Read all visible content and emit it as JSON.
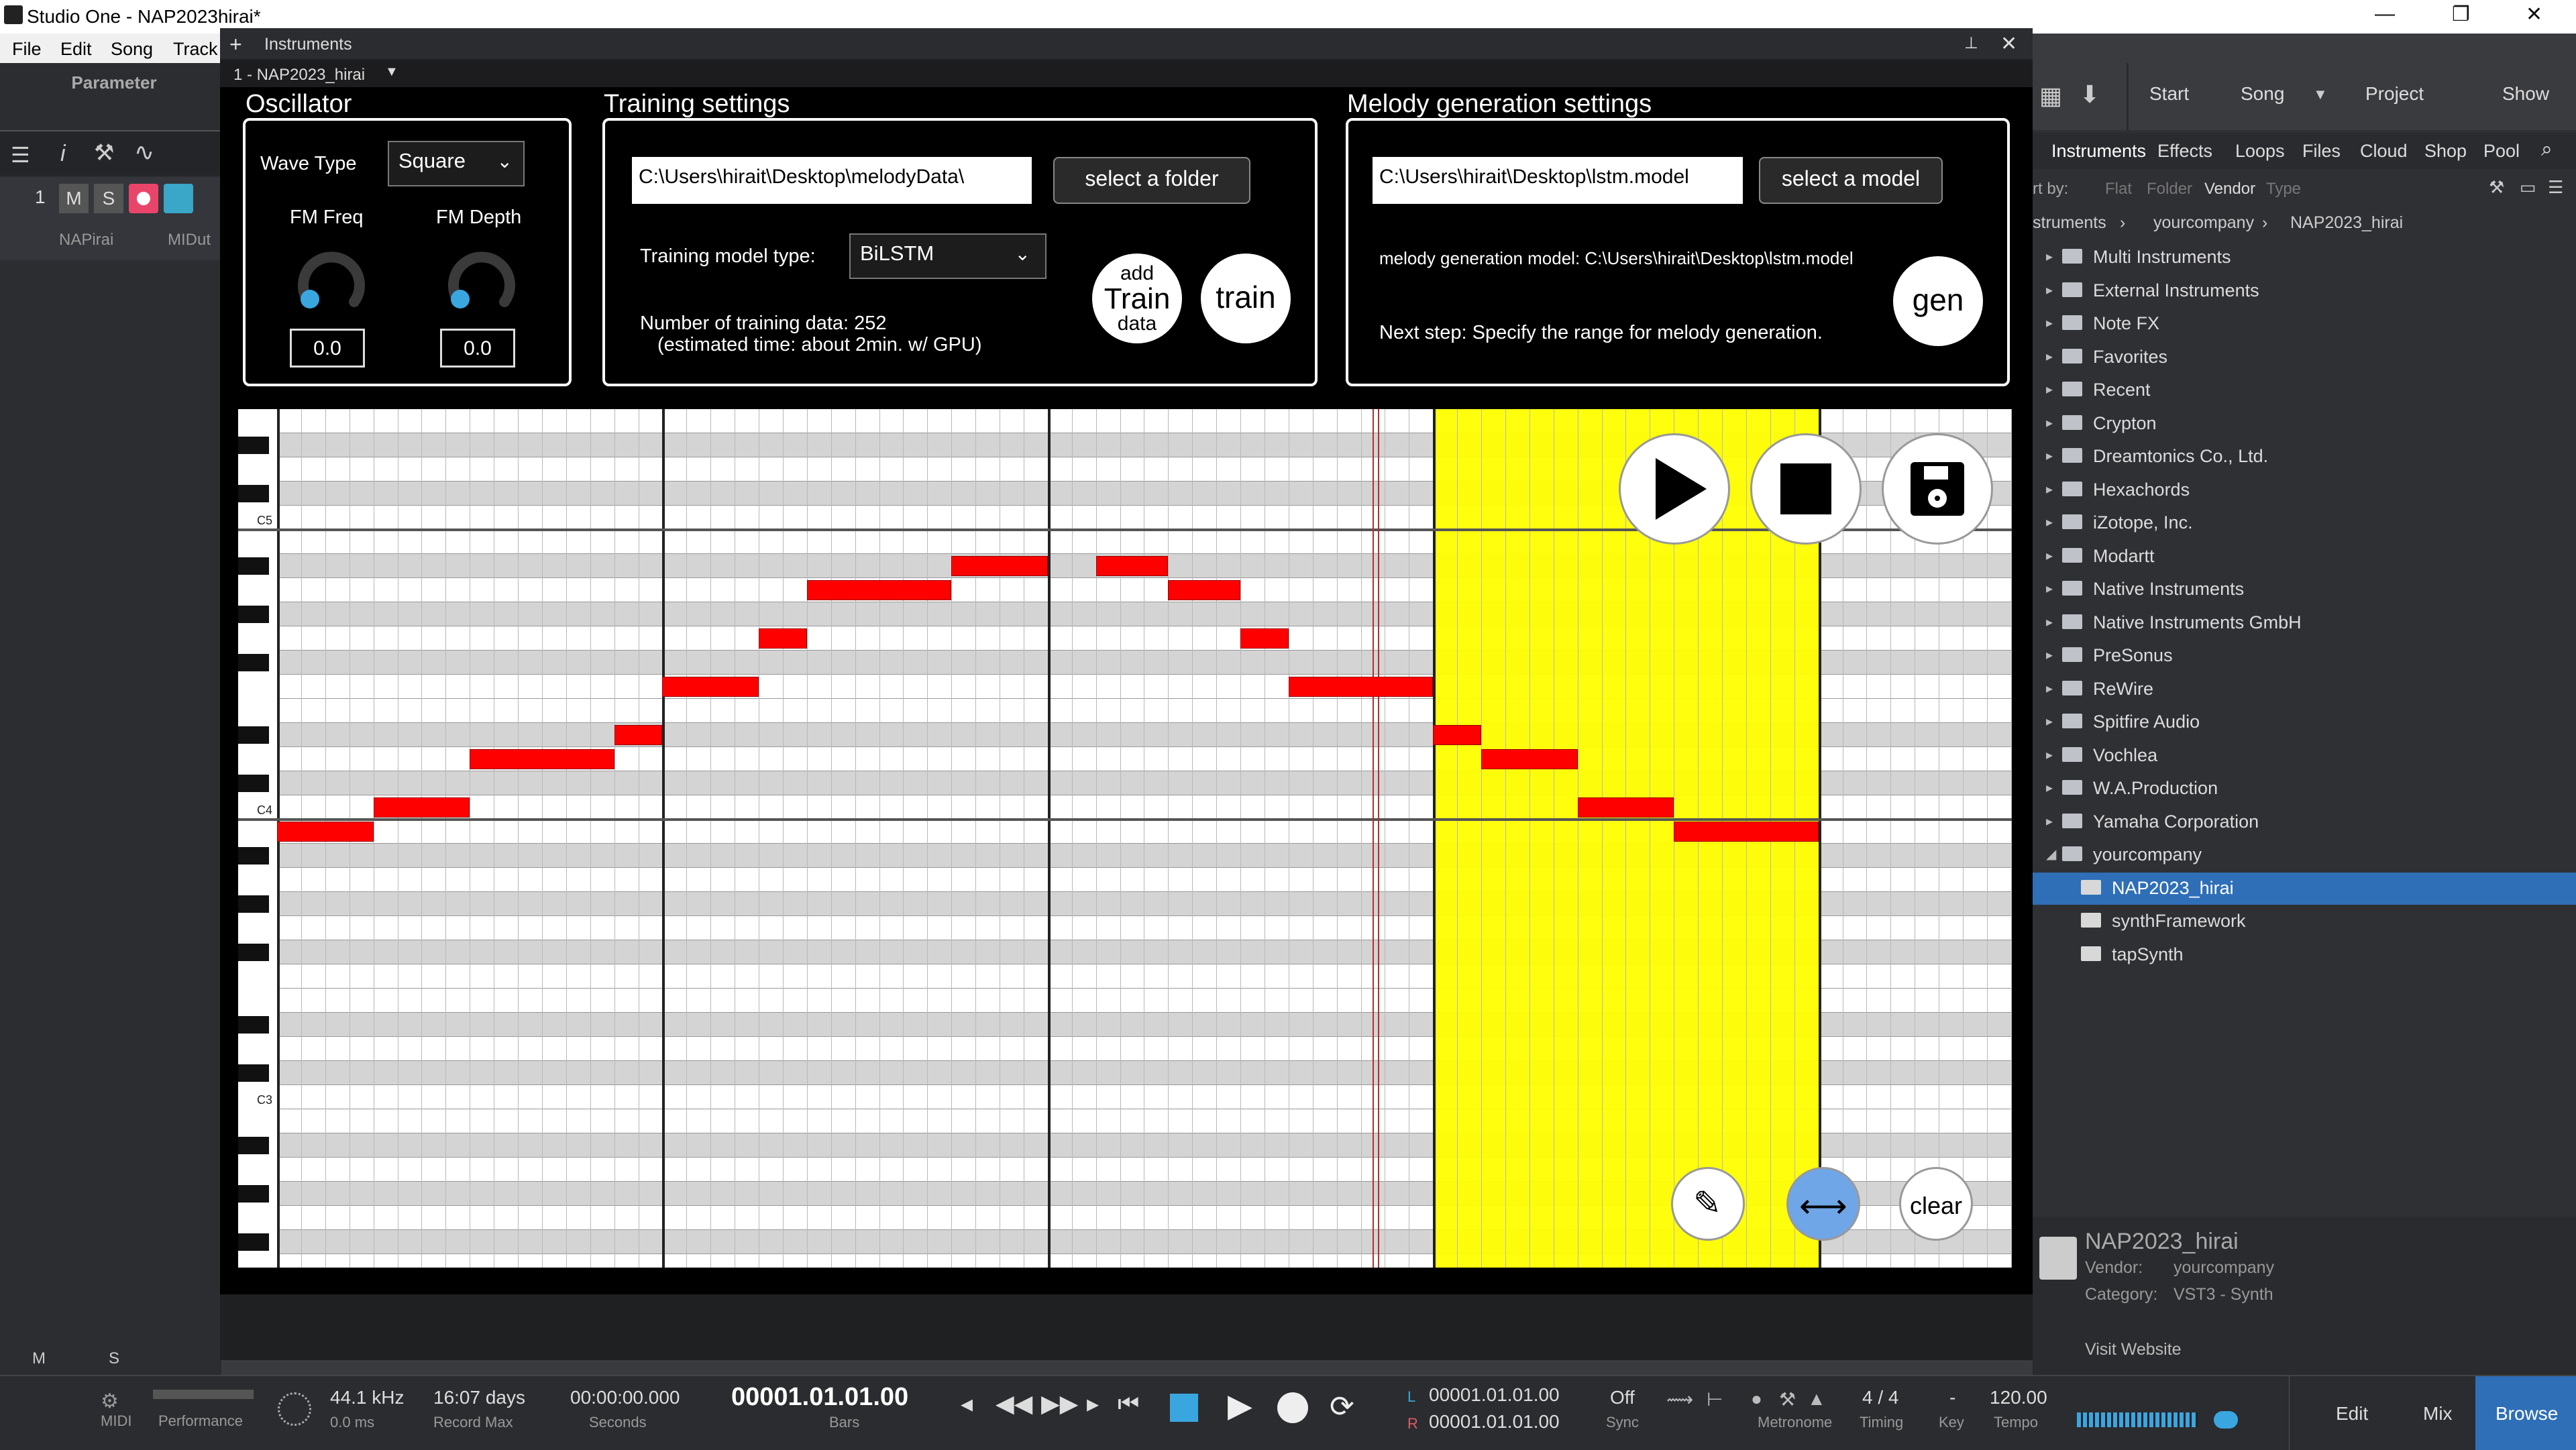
{
  "window": {
    "title": "Studio One - NAP2023hirai*",
    "minimize": "—",
    "maximize": "❐",
    "close": "✕"
  },
  "menu": [
    "File",
    "Edit",
    "Song",
    "Track"
  ],
  "left": {
    "parameter_label": "Parameter",
    "track_number": "1",
    "track_buttons": [
      "M",
      "S"
    ],
    "instrument_tag": "NAPirai",
    "midi_tag": "MIDut",
    "bottom_m": "M",
    "bottom_s": "S"
  },
  "plugin": {
    "header": "Instruments",
    "add": "+",
    "pin": "📌",
    "close": "✕",
    "preset": "1 - NAP2023_hirai",
    "oscillator": {
      "title": "Oscillator",
      "wave_type_label": "Wave Type",
      "wave_type_value": "Square",
      "fm_freq_label": "FM Freq",
      "fm_depth_label": "FM Depth",
      "fm_freq_value": "0.0",
      "fm_depth_value": "0.0"
    },
    "training": {
      "title": "Training settings",
      "folder_path": "C:\\Users\\hirait\\Desktop\\melodyData\\",
      "select_folder": "select a folder",
      "model_type_label": "Training model type:",
      "model_type_value": "BiLSTM",
      "data_count": "Number of training data: 252",
      "estimate": "(estimated time: about 2min. w/ GPU)",
      "add_btn_1": "add",
      "add_btn_2": "Train",
      "add_btn_3": "data",
      "train_btn": "train"
    },
    "generation": {
      "title": "Melody generation settings",
      "model_path": "C:\\Users\\hirait\\Desktop\\lstm.model",
      "select_model": "select a model",
      "model_label": "melody generation model: C:\\Users\\hirait\\Desktop\\lstm.model",
      "next_step": "Next step: Specify the range for melody generation.",
      "gen_btn": "gen"
    },
    "roll": {
      "labels": {
        "c5": "C5",
        "c4": "C4",
        "c3": "C3"
      },
      "clear": "clear"
    }
  },
  "browser": {
    "top_tabs": [
      "Start",
      "Song",
      "Project",
      "Show"
    ],
    "tabs": [
      "Instruments",
      "Effects",
      "Loops",
      "Files",
      "Cloud",
      "Shop",
      "Pool"
    ],
    "sort_label": "rt by:",
    "sort_opts": [
      "Flat",
      "Folder",
      "Vendor",
      "Type"
    ],
    "breadcrumb": [
      "struments",
      "yourcompany",
      "NAP2023_hirai"
    ],
    "items": [
      {
        "name": "Multi Instruments",
        "type": "cat"
      },
      {
        "name": "External Instruments",
        "type": "cat"
      },
      {
        "name": "Note FX",
        "type": "cat"
      },
      {
        "name": "Favorites",
        "type": "cat"
      },
      {
        "name": "Recent",
        "type": "cat"
      },
      {
        "name": "Crypton",
        "type": "folder"
      },
      {
        "name": "Dreamtonics Co., Ltd.",
        "type": "folder"
      },
      {
        "name": "Hexachords",
        "type": "folder"
      },
      {
        "name": "iZotope, Inc.",
        "type": "folder"
      },
      {
        "name": "Modartt",
        "type": "folder"
      },
      {
        "name": "Native Instruments",
        "type": "folder"
      },
      {
        "name": "Native Instruments GmbH",
        "type": "folder"
      },
      {
        "name": "PreSonus",
        "type": "folder"
      },
      {
        "name": "ReWire",
        "type": "folder"
      },
      {
        "name": "Spitfire Audio",
        "type": "folder"
      },
      {
        "name": "Vochlea",
        "type": "folder"
      },
      {
        "name": "W.A.Production",
        "type": "folder"
      },
      {
        "name": "Yamaha Corporation",
        "type": "folder"
      },
      {
        "name": "yourcompany",
        "type": "open"
      },
      {
        "name": "NAP2023_hirai",
        "type": "plugin",
        "selected": true
      },
      {
        "name": "synthFramework",
        "type": "plugin"
      },
      {
        "name": "tapSynth",
        "type": "plugin"
      }
    ],
    "info": {
      "name": "NAP2023_hirai",
      "vendor_label": "Vendor:",
      "vendor": "yourcompany",
      "category_label": "Category:",
      "category": "VST3 - Synth",
      "visit": "Visit Website"
    }
  },
  "transport": {
    "midi": "MIDI",
    "performance": "Performance",
    "sample_rate": "44.1 kHz",
    "latency": "0.0 ms",
    "record_days": "16:07 days",
    "record_max": "Record Max",
    "seconds_value": "00:00:00.000",
    "seconds": "Seconds",
    "bars_value": "00001.01.01.00",
    "bars": "Bars",
    "loop_l": "00001.01.01.00",
    "loop_r": "00001.01.01.00",
    "l": "L",
    "r": "R",
    "sync_value": "Off",
    "sync": "Sync",
    "metronome": "Metronome",
    "timing_value": "4 / 4",
    "timing": "Timing",
    "key_value": "-",
    "key": "Key",
    "tempo_value": "120.00",
    "tempo": "Tempo",
    "edit": "Edit",
    "mix": "Mix",
    "browse": "Browse"
  }
}
